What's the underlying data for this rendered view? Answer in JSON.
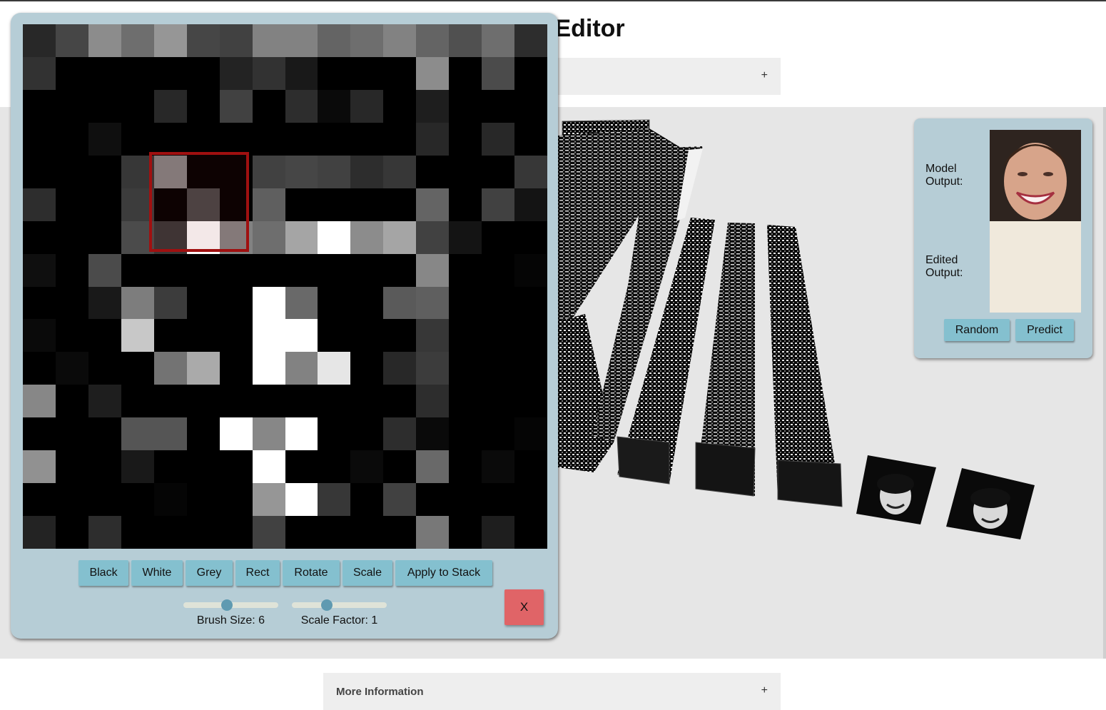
{
  "page": {
    "title": "Map Editor",
    "more_info_label": "More Information",
    "expand_symbol": "+"
  },
  "output_panel": {
    "model_output_label": "Model Output:",
    "edited_output_label": "Edited Output:",
    "random_label": "Random",
    "predict_label": "Predict"
  },
  "editor": {
    "buttons": [
      "Black",
      "White",
      "Grey",
      "Rect",
      "Rotate",
      "Scale",
      "Apply to Stack"
    ],
    "close_label": "X",
    "brush_size": {
      "label": "Brush Size: 6",
      "value": 6,
      "fraction": 0.45
    },
    "scale_factor": {
      "label": "Scale Factor: 1",
      "value": 1,
      "fraction": 0.35
    },
    "feature_map": [
      [
        40,
        70,
        140,
        110,
        150,
        70,
        65,
        130,
        130,
        100,
        110,
        130,
        100,
        80,
        110,
        45
      ],
      [
        50,
        0,
        0,
        0,
        0,
        0,
        35,
        50,
        25,
        0,
        0,
        0,
        140,
        0,
        75,
        0
      ],
      [
        0,
        0,
        0,
        0,
        40,
        0,
        65,
        0,
        45,
        10,
        40,
        0,
        30,
        0,
        0,
        0
      ],
      [
        0,
        0,
        15,
        0,
        0,
        0,
        0,
        0,
        0,
        0,
        0,
        0,
        40,
        0,
        40,
        0
      ],
      [
        0,
        0,
        0,
        55,
        130,
        0,
        0,
        65,
        70,
        65,
        45,
        55,
        0,
        0,
        0,
        55
      ],
      [
        45,
        0,
        0,
        60,
        0,
        70,
        0,
        95,
        0,
        0,
        0,
        0,
        100,
        0,
        65,
        20
      ],
      [
        0,
        0,
        0,
        75,
        55,
        250,
        130,
        110,
        165,
        255,
        140,
        165,
        65,
        20,
        0,
        0
      ],
      [
        15,
        0,
        75,
        0,
        0,
        0,
        0,
        0,
        0,
        0,
        0,
        0,
        135,
        0,
        0,
        5
      ],
      [
        0,
        0,
        25,
        125,
        60,
        0,
        0,
        255,
        105,
        0,
        0,
        90,
        95,
        0,
        0,
        0
      ],
      [
        10,
        0,
        0,
        200,
        0,
        0,
        0,
        255,
        255,
        0,
        0,
        0,
        55,
        0,
        0,
        0
      ],
      [
        0,
        10,
        0,
        0,
        115,
        170,
        0,
        255,
        130,
        230,
        0,
        40,
        60,
        0,
        0,
        0
      ],
      [
        135,
        0,
        30,
        0,
        0,
        0,
        0,
        0,
        0,
        0,
        0,
        0,
        45,
        0,
        0,
        0
      ],
      [
        0,
        0,
        0,
        85,
        85,
        0,
        255,
        135,
        255,
        0,
        0,
        45,
        10,
        0,
        0,
        5
      ],
      [
        145,
        0,
        0,
        25,
        0,
        0,
        0,
        255,
        0,
        0,
        10,
        0,
        105,
        0,
        10,
        0
      ],
      [
        0,
        0,
        0,
        0,
        5,
        0,
        0,
        150,
        255,
        55,
        0,
        65,
        0,
        0,
        0,
        0
      ],
      [
        35,
        0,
        45,
        0,
        0,
        0,
        0,
        65,
        0,
        0,
        0,
        0,
        120,
        0,
        30,
        0
      ]
    ]
  }
}
